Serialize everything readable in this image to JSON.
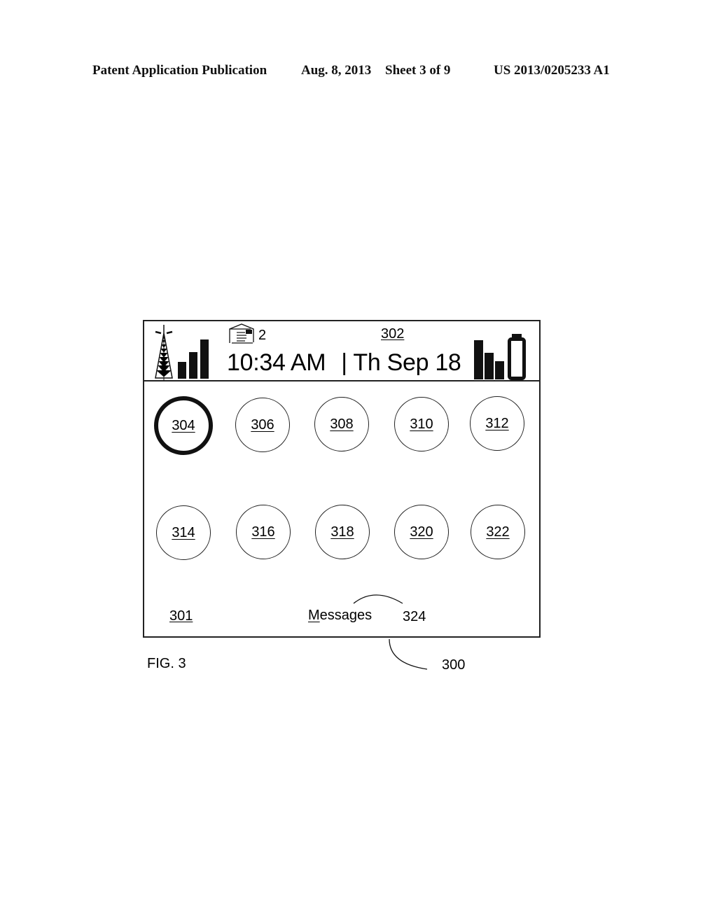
{
  "publication_header": {
    "title": "Patent Application Publication",
    "date": "Aug. 8, 2013",
    "sheet": "Sheet 3 of 9",
    "number": "US 2013/0205233 A1"
  },
  "figure": {
    "label": "FIG. 3",
    "reference": "300",
    "device_screen": {
      "status_bar": {
        "reference": "302",
        "icons": {
          "tower": "antenna-tower-icon",
          "signal": "signal-strength-icon",
          "mail": "envelope-icon",
          "bars": "level-bars-icon",
          "battery": "battery-icon"
        },
        "mail_count": "2",
        "time": "10:34 AM",
        "separator": "|",
        "date": "Th Sep 18",
        "signal_level_bars": "3 of 3",
        "battery_level": "empty outline"
      },
      "apps": [
        {
          "label": "304",
          "selected": true
        },
        {
          "label": "306",
          "selected": false
        },
        {
          "label": "308",
          "selected": false
        },
        {
          "label": "310",
          "selected": false
        },
        {
          "label": "312",
          "selected": false
        },
        {
          "label": "314",
          "selected": false
        },
        {
          "label": "316",
          "selected": false
        },
        {
          "label": "318",
          "selected": false
        },
        {
          "label": "320",
          "selected": false
        },
        {
          "label": "322",
          "selected": false
        }
      ],
      "footer": {
        "screen_reference": "301",
        "selected_app_name_first_letter": "M",
        "selected_app_name_rest": "essages",
        "selected_app_reference": "324"
      }
    }
  }
}
